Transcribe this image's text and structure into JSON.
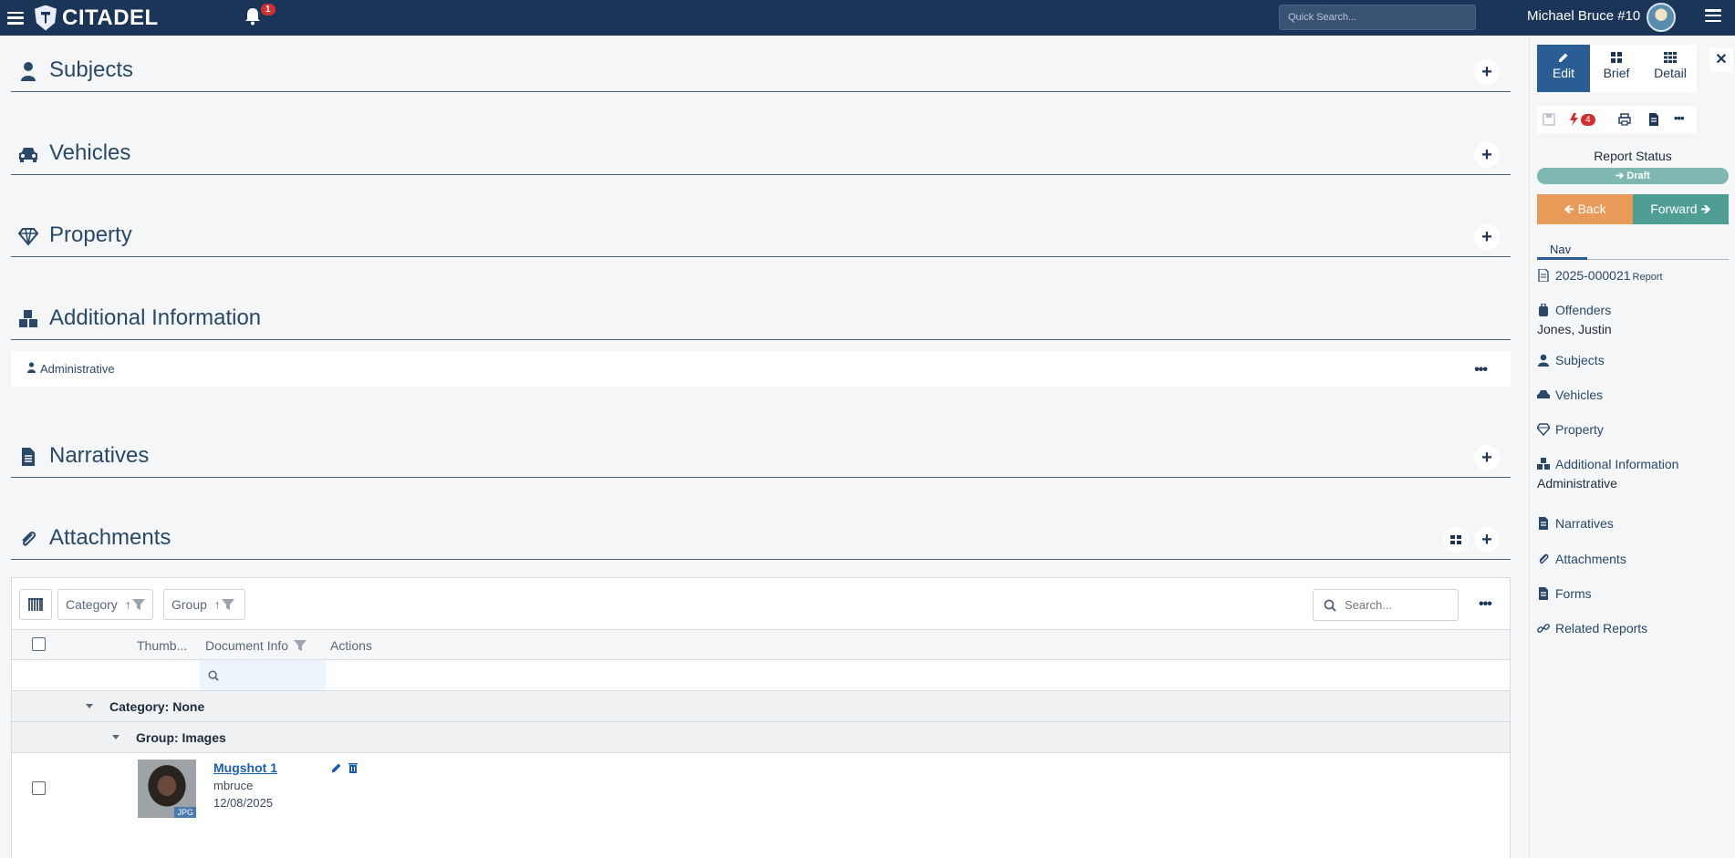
{
  "app": {
    "brand": "CITADEL",
    "notification_count": "1",
    "quick_search_placeholder": "Quick Search...",
    "user_name": "Michael Bruce  #10"
  },
  "sections": {
    "subjects": "Subjects",
    "vehicles": "Vehicles",
    "property": "Property",
    "additional_information": "Additional Information",
    "administrative_row": "Administrative",
    "narratives": "Narratives",
    "attachments": "Attachments"
  },
  "attachments_grid": {
    "filter_category": "Category",
    "filter_group": "Group",
    "search_placeholder": "Search...",
    "columns": [
      "Thumb...",
      "Document Info",
      "Actions"
    ],
    "category_row": "Category: None",
    "group_row": "Group: Images",
    "rows": [
      {
        "title": "Mugshot 1",
        "author": "mbruce",
        "date": "12/08/2025",
        "thumb_label": "JPG"
      }
    ]
  },
  "right_panel": {
    "modes": [
      "Edit",
      "Brief",
      "Detail"
    ],
    "flag_count": "4",
    "status_label": "Report Status",
    "status_value": "Draft",
    "back_label": "Back",
    "forward_label": "Forward",
    "nav_tab": "Nav",
    "report_number": "2025-000021",
    "report_tag": "Report",
    "nav_items": {
      "offenders": "Offenders",
      "offender_name": "Jones, Justin",
      "subjects": "Subjects",
      "vehicles": "Vehicles",
      "property": "Property",
      "additional_information": "Additional Information",
      "additional_sub": "Administrative",
      "narratives": "Narratives",
      "attachments": "Attachments",
      "forms": "Forms",
      "related_reports": "Related Reports"
    }
  },
  "colors": {
    "topbar": "#1b3558",
    "accent": "#2a5d94",
    "back": "#e89b59",
    "forward": "#4e9e94",
    "status": "#7fb8b0",
    "badge": "#d32f2f"
  }
}
